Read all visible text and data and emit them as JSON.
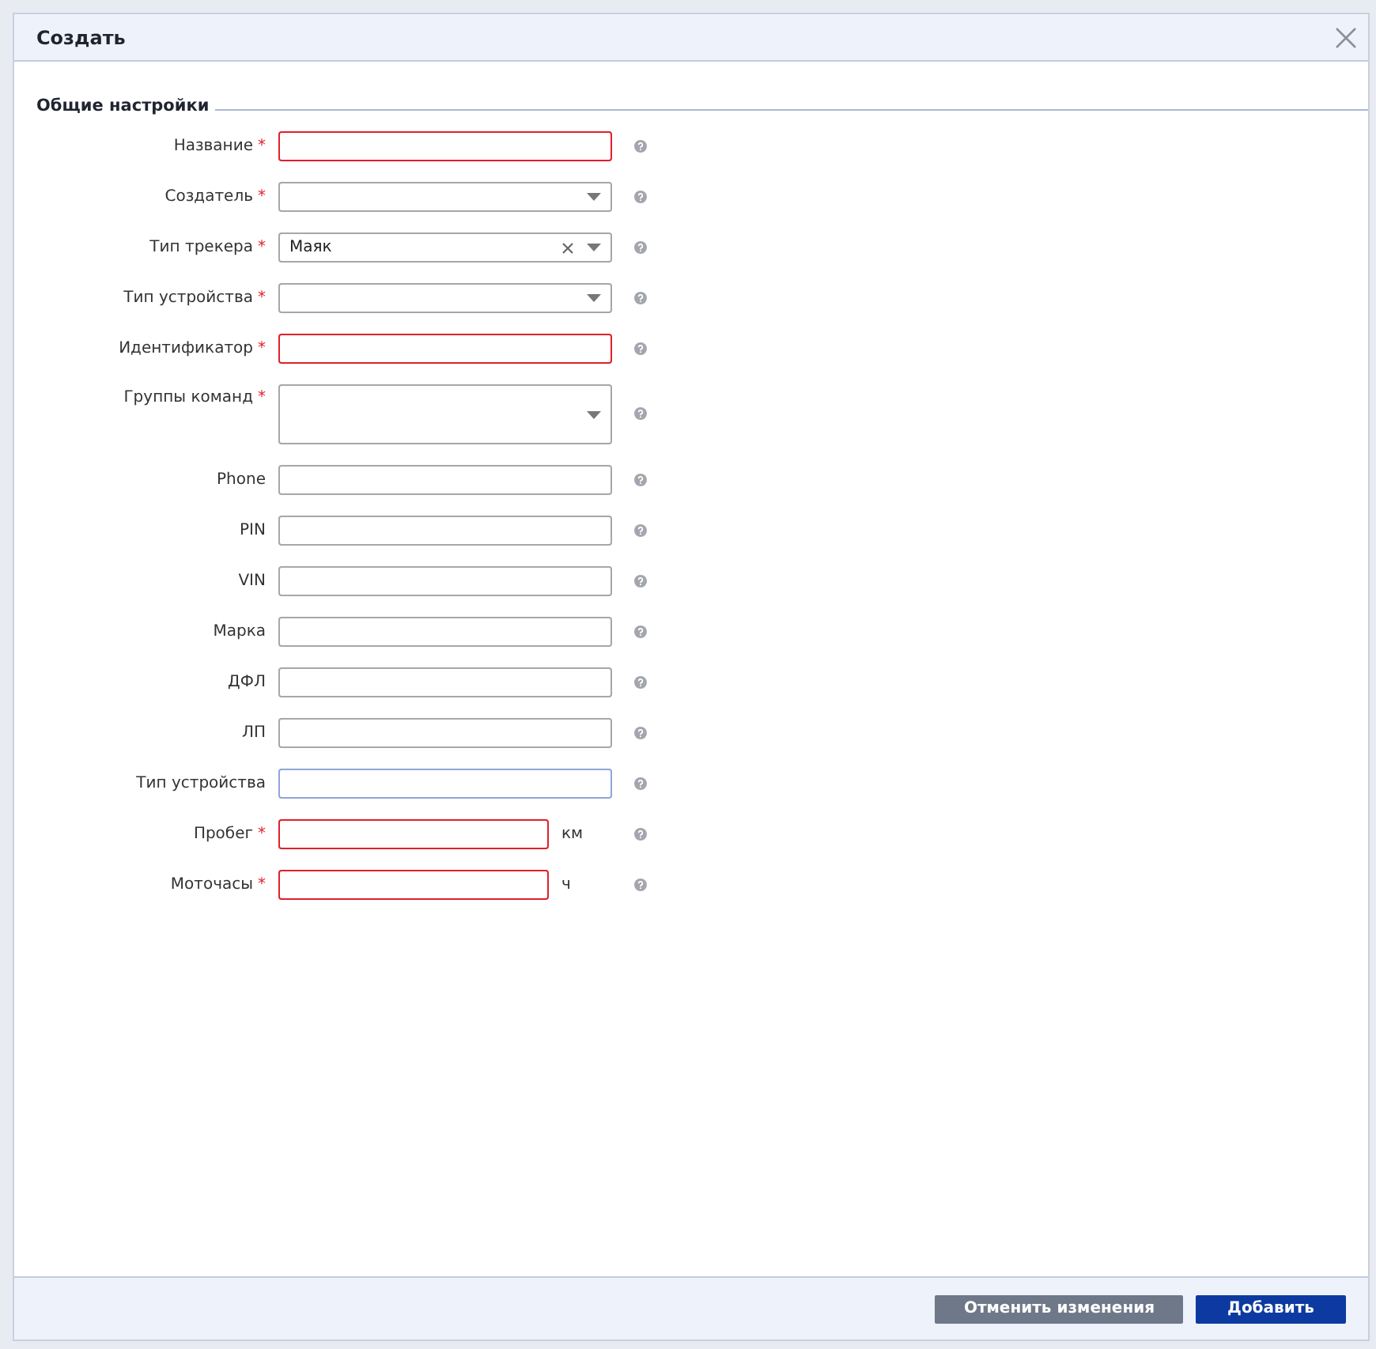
{
  "dialog": {
    "title": "Создать"
  },
  "section": {
    "title": "Общие настройки"
  },
  "fields": [
    {
      "label": "Название",
      "required_mark": "*",
      "kind": "text",
      "invalid": true,
      "focused": false
    },
    {
      "label": "Создатель",
      "required_mark": "*",
      "kind": "select",
      "invalid": false,
      "focused": false
    },
    {
      "label": "Тип трекера",
      "required_mark": "*",
      "kind": "select",
      "value": "Маяк",
      "clearable": true,
      "invalid": false,
      "focused": false
    },
    {
      "label": "Тип устройства",
      "required_mark": "*",
      "kind": "select",
      "invalid": false,
      "focused": false
    },
    {
      "label": "Идентификатор",
      "required_mark": "*",
      "kind": "text",
      "invalid": true,
      "focused": false
    },
    {
      "label": "Группы команд",
      "required_mark": "*",
      "kind": "multiselect",
      "invalid": false,
      "focused": false
    },
    {
      "label": "Phone",
      "kind": "text",
      "invalid": false,
      "focused": false
    },
    {
      "label": "PIN",
      "kind": "text",
      "invalid": false,
      "focused": false
    },
    {
      "label": "VIN",
      "kind": "text",
      "invalid": false,
      "focused": false
    },
    {
      "label": "Марка",
      "kind": "text",
      "invalid": false,
      "focused": false
    },
    {
      "label": "ДФЛ",
      "kind": "text",
      "invalid": false,
      "focused": false
    },
    {
      "label": "ЛП",
      "kind": "text",
      "invalid": false,
      "focused": false
    },
    {
      "label": "Тип устройства",
      "kind": "text",
      "invalid": false,
      "focused": true
    },
    {
      "label": "Пробег",
      "required_mark": "*",
      "kind": "text",
      "unit": "км",
      "invalid": true,
      "focused": false
    },
    {
      "label": "Моточасы",
      "required_mark": "*",
      "kind": "text",
      "unit": "ч",
      "invalid": true,
      "focused": false
    }
  ],
  "buttons": [
    {
      "label": "Отменить изменения",
      "kind": "secondary"
    },
    {
      "label": "Добавить",
      "kind": "primary"
    }
  ]
}
